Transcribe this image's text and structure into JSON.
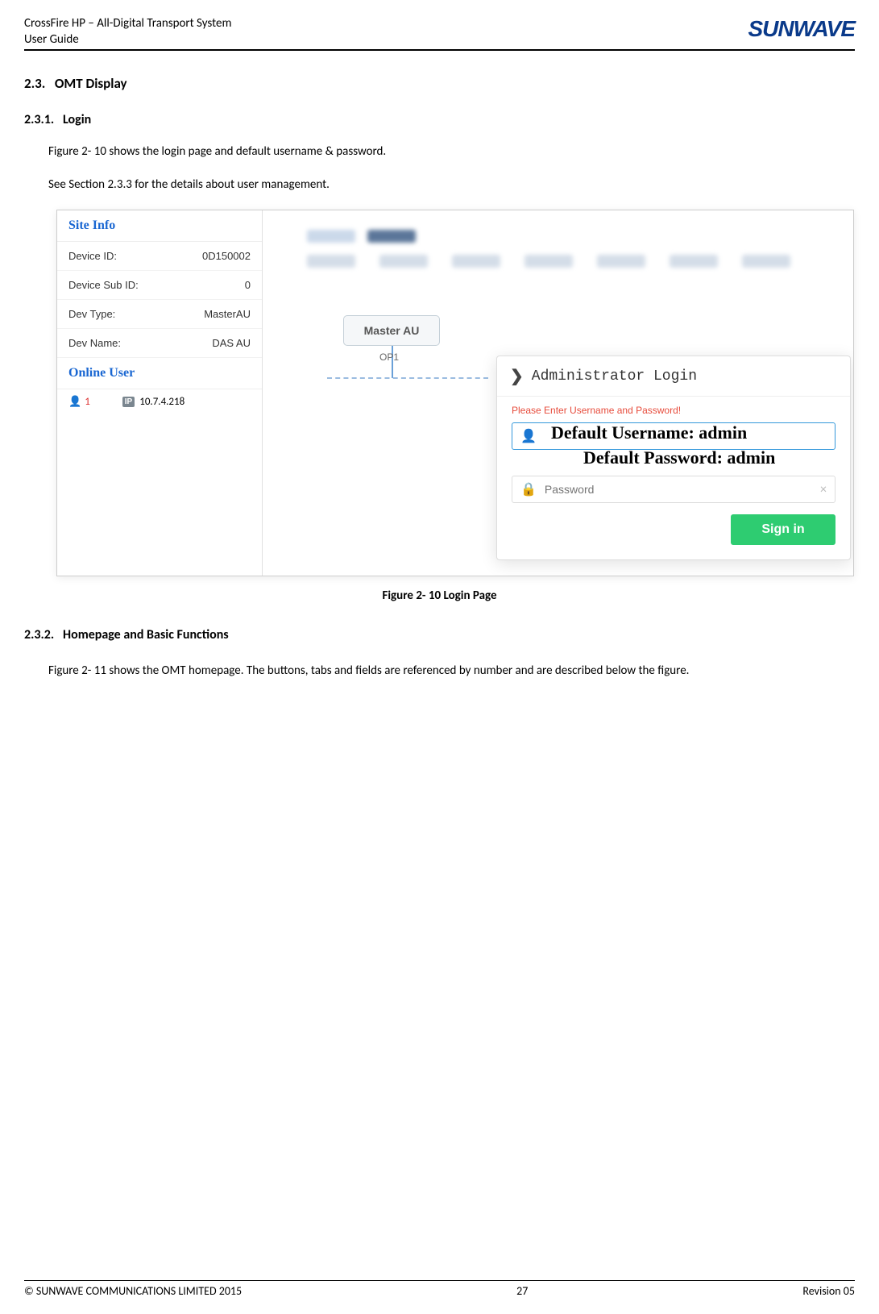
{
  "header": {
    "product_line": "CrossFire HP – All-Digital Transport System",
    "doc_type": "User Guide",
    "brand": "SUNWAVE"
  },
  "sections": {
    "s23_num": "2.3.",
    "s23_title": "OMT Display",
    "s231_num": "2.3.1.",
    "s231_title": "Login",
    "p1": "Figure 2- 10 shows the login page and default username & password.",
    "p2": "See Section 2.3.3 for the details about user management.",
    "fig_caption": "Figure 2- 10 Login Page",
    "s232_num": "2.3.2.",
    "s232_title": "Homepage and Basic Functions",
    "p3": "Figure 2- 11 shows the OMT homepage. The buttons, tabs and fields are referenced by number and are described below the figure."
  },
  "screenshot": {
    "site_info_header": "Site Info",
    "device_id_label": "Device ID:",
    "device_id_val": "0D150002",
    "device_subid_label": "Device Sub ID:",
    "device_subid_val": "0",
    "dev_type_label": "Dev Type:",
    "dev_type_val": "MasterAU",
    "dev_name_label": "Dev Name:",
    "dev_name_val": "DAS AU",
    "online_user_header": "Online User",
    "online_count": "1",
    "online_ip": "10.7.4.218",
    "node_label": "Master AU",
    "op_label": "OP1",
    "modal_title": "Administrator Login",
    "err_msg": "Please Enter Username and Password!",
    "password_placeholder": "Password",
    "signin": "Sign in",
    "overlay_user": "Default Username: admin",
    "overlay_pass": "Default Password: admin",
    "ip_badge": "IP"
  },
  "footer": {
    "copyright": "© SUNWAVE COMMUNICATIONS LIMITED 2015",
    "page": "27",
    "revision": "Revision 05"
  }
}
